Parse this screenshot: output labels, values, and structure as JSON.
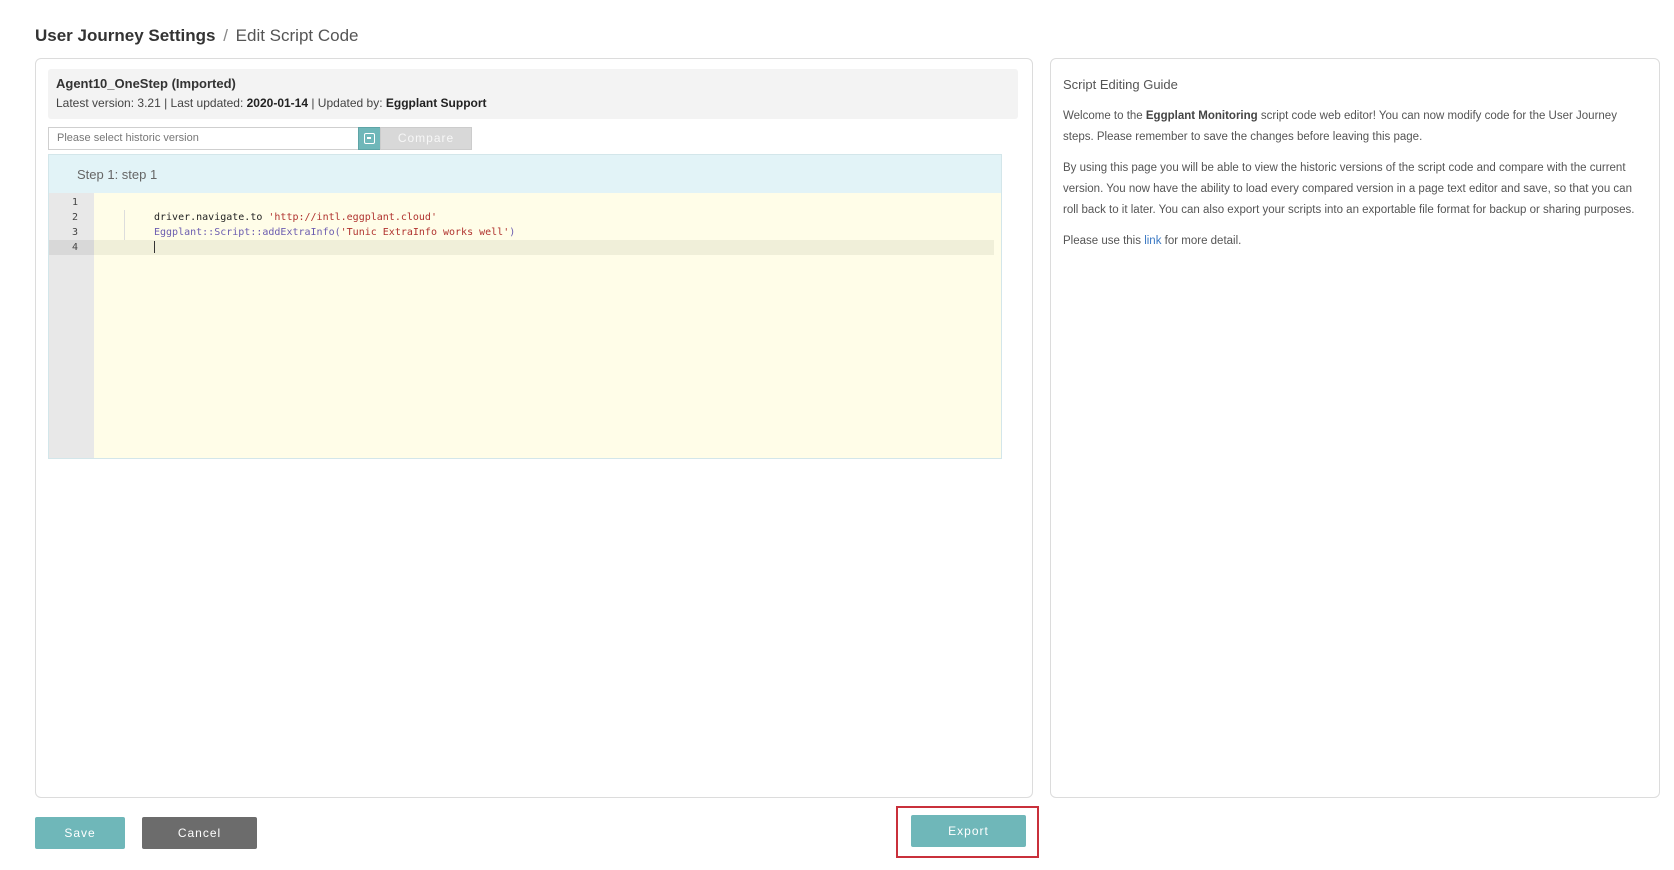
{
  "header": {
    "crumb_root": "User Journey Settings",
    "crumb_sep": "/",
    "crumb_current": "Edit Script Code"
  },
  "script_info": {
    "name": "Agent10_OneStep (Imported)",
    "latest_version_label": "Latest version:",
    "latest_version": "3.21",
    "last_updated_label": "| Last updated:",
    "last_updated": "2020-01-14",
    "updated_by_label": "| Updated by:",
    "updated_by": "Eggplant Support"
  },
  "version_select": {
    "placeholder": "Please select historic version"
  },
  "compare_label": "Compare",
  "editor": {
    "step_label": "Step 1: step 1",
    "line_numbers": [
      "1",
      "2",
      "3",
      "4"
    ],
    "line2_prefix": "driver.navigate.to ",
    "line2_string": "'http://intl.eggplant.cloud'",
    "line3_obj": "Eggplant::Script::addExtraInfo(",
    "line3_string": "'Tunic ExtraInfo works well'",
    "line3_suffix": ")"
  },
  "guide": {
    "title": "Script Editing Guide",
    "p1_before": "Welcome to the ",
    "p1_bold": "Eggplant Monitoring",
    "p1_after": " script code web editor! You can now modify code for the User Journey steps. Please remember to save the changes before leaving this page.",
    "p2": "By using this page you will be able to view the historic versions of the script code and compare with the current version. You now have the ability to load every compared version in a page text editor and save, so that you can roll back to it later. You can also export your scripts into an exportable file format for backup or sharing purposes.",
    "p3_before": "Please use this ",
    "p3_link": "link",
    "p3_after": " for more detail."
  },
  "actions": {
    "save_label": "Save",
    "cancel_label": "Cancel",
    "export_label": "Export"
  },
  "colors": {
    "accent": "#6fb7b9",
    "cancel": "#6c6c6c",
    "highlight": "#c9303b"
  }
}
